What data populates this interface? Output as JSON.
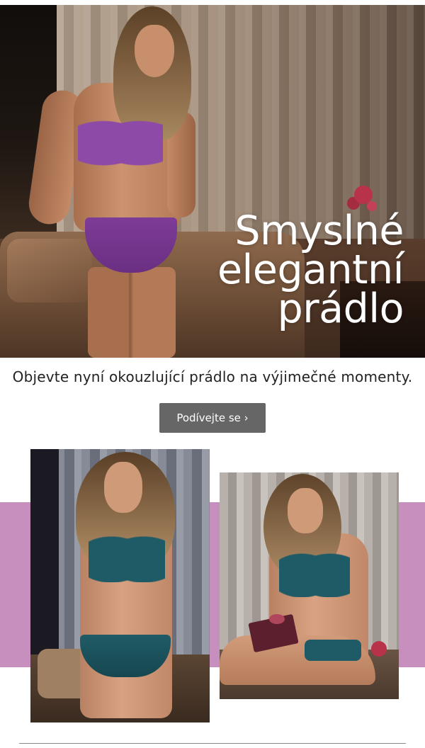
{
  "hero": {
    "title_lines": [
      "Smyslné",
      "elegantní",
      "prádlo"
    ],
    "image_label": "model-in-purple-lingerie"
  },
  "tagline": "Objevte nyní okouzlující prádlo na výjimečné momenty.",
  "cta": {
    "label": "Podívejte se ›"
  },
  "gallery": {
    "band_color": "#c68fbe",
    "lingerie_colors": {
      "hero": "#7d3c97",
      "gallery": "#1f5b66"
    }
  },
  "colors": {
    "button_bg": "#666666",
    "text": "#222222",
    "divider": "#8a8a8a"
  }
}
